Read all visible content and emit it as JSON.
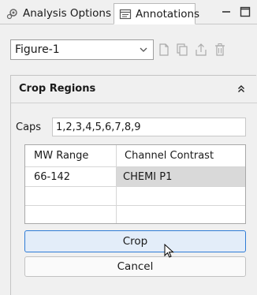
{
  "tabs": [
    {
      "label": "Analysis Options",
      "icon": "gear-doc-icon",
      "active": false
    },
    {
      "label": "Annotations",
      "icon": "annotations-icon",
      "active": true
    }
  ],
  "window_controls": {
    "minimize_icon": "minimize-icon",
    "maximize_icon": "maximize-icon"
  },
  "figure_select": {
    "value": "Figure-1"
  },
  "figure_actions": [
    "new-figure-icon",
    "copy-figure-icon",
    "export-figure-icon",
    "delete-figure-icon"
  ],
  "crop_panel": {
    "title": "Crop Regions",
    "caps_label": "Caps",
    "caps_value": "1,2,3,4,5,6,7,8,9",
    "table": {
      "columns": [
        "MW Range",
        "Channel Contrast"
      ],
      "rows": [
        [
          "66-142",
          "CHEMI P1"
        ]
      ]
    },
    "crop_label": "Crop",
    "cancel_label": "Cancel"
  },
  "colors": {
    "accent": "#2f7cd6",
    "crop_button_bg": "#e3edf9"
  }
}
